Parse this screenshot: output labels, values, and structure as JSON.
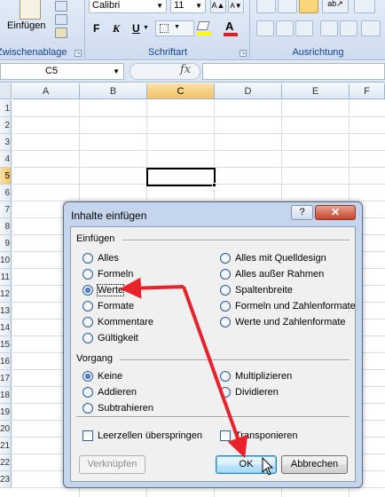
{
  "ribbon": {
    "clipboard": {
      "paste_label": "Einfügen",
      "group_label": "Zwischenablage"
    },
    "font": {
      "font_name": "Calibri",
      "font_size": "11",
      "bold": "F",
      "italic": "K",
      "underline": "U",
      "group_label": "Schriftart"
    },
    "alignment": {
      "group_label": "Ausrichtung"
    }
  },
  "formula_bar": {
    "name_box": "C5",
    "fx": "fx",
    "formula": ""
  },
  "grid": {
    "columns": [
      "A",
      "B",
      "C",
      "D",
      "E",
      "F"
    ],
    "rows": [
      "1",
      "2",
      "3",
      "4",
      "5",
      "6",
      "7",
      "8",
      "9",
      "10",
      "11",
      "12",
      "13",
      "14",
      "15",
      "16",
      "17",
      "18",
      "19",
      "20",
      "21",
      "22",
      "23"
    ],
    "selected_column": "C",
    "selected_row": "5",
    "active_cell": "C5"
  },
  "dialog": {
    "title": "Inhalte einfügen",
    "help": "?",
    "close": "✕",
    "paste_section": "Einfügen",
    "paste_options_left": [
      {
        "label": "Alles",
        "checked": false
      },
      {
        "label": "Formeln",
        "checked": false
      },
      {
        "label": "Werte",
        "checked": true
      },
      {
        "label": "Formate",
        "checked": false
      },
      {
        "label": "Kommentare",
        "checked": false
      },
      {
        "label": "Gültigkeit",
        "checked": false
      }
    ],
    "paste_options_right": [
      {
        "label": "Alles mit Quelldesign",
        "checked": false
      },
      {
        "label": "Alles außer Rahmen",
        "checked": false
      },
      {
        "label": "Spaltenbreite",
        "checked": false
      },
      {
        "label": "Formeln und Zahlenformate",
        "checked": false
      },
      {
        "label": "Werte und Zahlenformate",
        "checked": false
      }
    ],
    "operation_section": "Vorgang",
    "operation_left": [
      {
        "label": "Keine",
        "checked": true
      },
      {
        "label": "Addieren",
        "checked": false
      },
      {
        "label": "Subtrahieren",
        "checked": false
      }
    ],
    "operation_right": [
      {
        "label": "Multiplizieren",
        "checked": false
      },
      {
        "label": "Dividieren",
        "checked": false
      }
    ],
    "skip_blanks": "Leerzellen überspringen",
    "transpose": "Transponieren",
    "link_button": "Verknüpfen",
    "ok_button": "OK",
    "cancel_button": "Abbrechen"
  },
  "annotation_color": "#e8212b"
}
